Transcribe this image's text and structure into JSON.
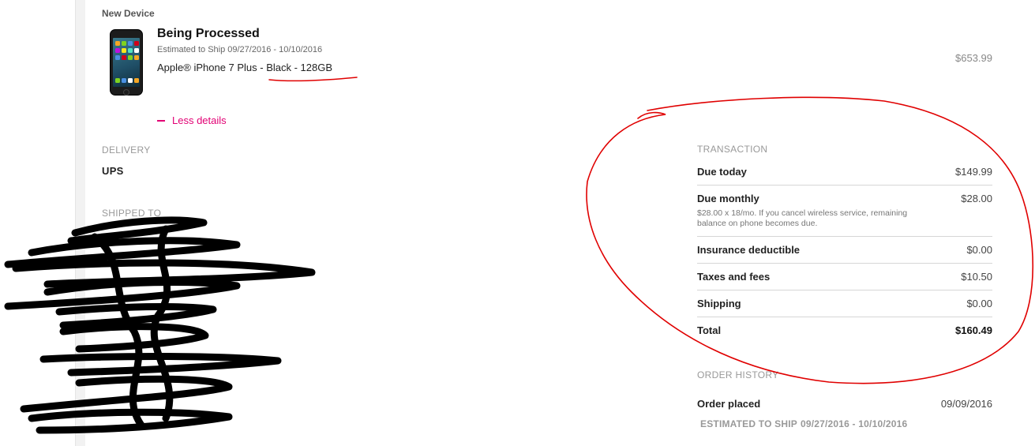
{
  "device": {
    "section_label": "New Device",
    "status": "Being Processed",
    "ship_estimate": "Estimated to Ship 09/27/2016 - 10/10/2016",
    "product_name": "Apple® iPhone 7 Plus - Black - 128GB",
    "price": "$653.99",
    "less_details_label": "Less details"
  },
  "delivery": {
    "label": "DELIVERY",
    "value": "UPS"
  },
  "shipped_to": {
    "label": "SHIPPED TO"
  },
  "transaction": {
    "label": "TRANSACTION",
    "rows": [
      {
        "label": "Due today",
        "value": "$149.99"
      },
      {
        "label": "Due monthly",
        "value": "$28.00",
        "note": "$28.00 x 18/mo. If you cancel wireless service, remaining balance on phone becomes due."
      },
      {
        "label": "Insurance deductible",
        "value": "$0.00"
      },
      {
        "label": "Taxes and fees",
        "value": "$10.50"
      },
      {
        "label": "Shipping",
        "value": "$0.00"
      },
      {
        "label": "Total",
        "value": "$160.49"
      }
    ]
  },
  "order_history": {
    "label": "ORDER HISTORY",
    "order_placed_label": "Order placed",
    "order_placed_value": "09/09/2016",
    "estimated_ship_label": "ESTIMATED TO SHIP",
    "estimated_ship_value": "09/27/2016 - 10/10/2016"
  },
  "colors": {
    "accent": "#e20074",
    "annotation_red": "#e00000",
    "redaction_black": "#000000"
  }
}
